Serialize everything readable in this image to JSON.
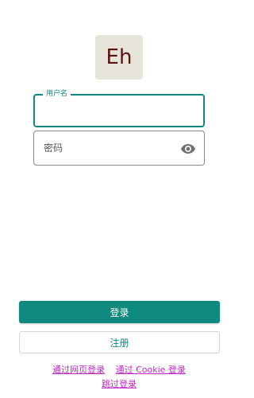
{
  "logo": {
    "text": "Eh"
  },
  "username": {
    "label": "用户名",
    "value": ""
  },
  "password": {
    "placeholder": "密码",
    "value": ""
  },
  "buttons": {
    "login": "登录",
    "register": "注册"
  },
  "links": {
    "web_login": "通过网页登录",
    "cookie_login": "通过 Cookie 登录",
    "skip_login": "跳过登录"
  },
  "colors": {
    "accent": "#0f8a7e",
    "link": "#c028c8",
    "logo_bg": "#e6e3d9",
    "logo_text": "#5a1410"
  },
  "icons": {
    "password_toggle": "eye-icon"
  }
}
